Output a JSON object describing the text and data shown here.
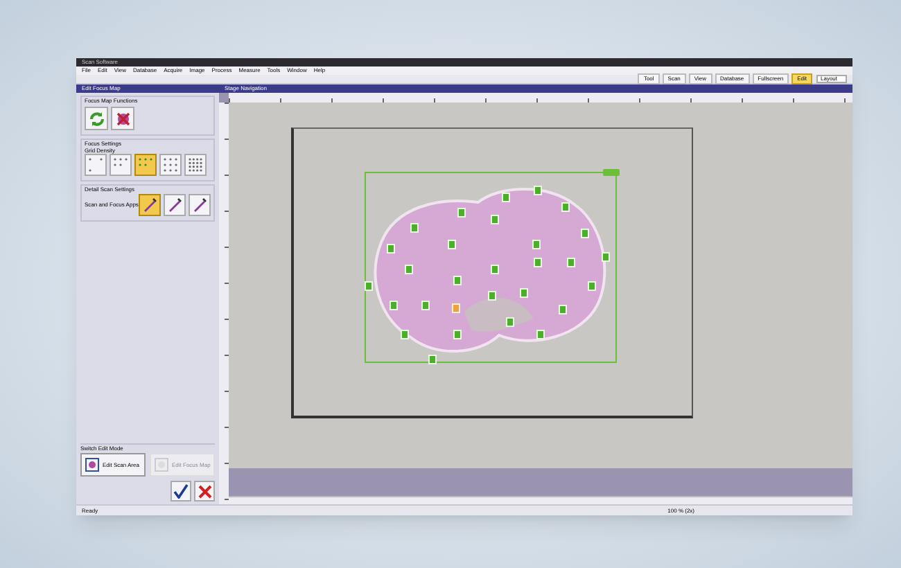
{
  "window": {
    "title": "Scan Software"
  },
  "menu": [
    "File",
    "Edit",
    "View",
    "Database",
    "Acquire",
    "Image",
    "Process",
    "Measure",
    "Tools",
    "Window",
    "Help"
  ],
  "workspaces": [
    {
      "label": "Tool",
      "selected": false
    },
    {
      "label": "Scan",
      "selected": false
    },
    {
      "label": "View",
      "selected": false
    },
    {
      "label": "Database",
      "selected": false
    },
    {
      "label": "Fullscreen",
      "selected": false
    },
    {
      "label": "Edit",
      "selected": true
    }
  ],
  "layout_select": {
    "value": "Layout"
  },
  "left_panel": {
    "title": "Edit Focus Map",
    "functions": {
      "title": "Focus Map Functions"
    },
    "focus_settings": {
      "title": "Focus Settings",
      "subtitle": "Grid Density",
      "density": [
        {
          "selected": false
        },
        {
          "selected": false
        },
        {
          "selected": true
        },
        {
          "selected": false
        },
        {
          "selected": false
        }
      ]
    },
    "detail": {
      "title": "Detail Scan Settings",
      "label": "Scan and Focus Apps",
      "modes": [
        {
          "selected": true
        },
        {
          "selected": false
        },
        {
          "selected": false
        }
      ]
    },
    "edit_mode": {
      "title": "Switch Edit Mode",
      "buttons": [
        {
          "label": "Edit Scan Area",
          "disabled": false
        },
        {
          "label": "Edit Focus Map",
          "disabled": true
        }
      ]
    }
  },
  "viewer": {
    "title": "Stage Navigation",
    "zoom": "100 % (2x)",
    "focus_points": [
      {
        "selected": false
      },
      {
        "selected": false
      },
      {
        "selected": false
      },
      {
        "selected": false
      },
      {
        "selected": false
      },
      {
        "selected": false
      },
      {
        "selected": false
      },
      {
        "selected": false
      },
      {
        "selected": false
      },
      {
        "selected": false
      },
      {
        "selected": false
      },
      {
        "selected": false
      },
      {
        "selected": false
      },
      {
        "selected": false
      },
      {
        "selected": false
      },
      {
        "selected": false
      },
      {
        "selected": false
      },
      {
        "selected": false
      },
      {
        "selected": false
      },
      {
        "selected": false
      },
      {
        "selected": false
      },
      {
        "selected": false
      },
      {
        "selected": true
      },
      {
        "selected": false
      },
      {
        "selected": false
      },
      {
        "selected": false
      },
      {
        "selected": false
      },
      {
        "selected": false
      },
      {
        "selected": false
      }
    ]
  },
  "status_bar": {
    "text": "Ready"
  }
}
